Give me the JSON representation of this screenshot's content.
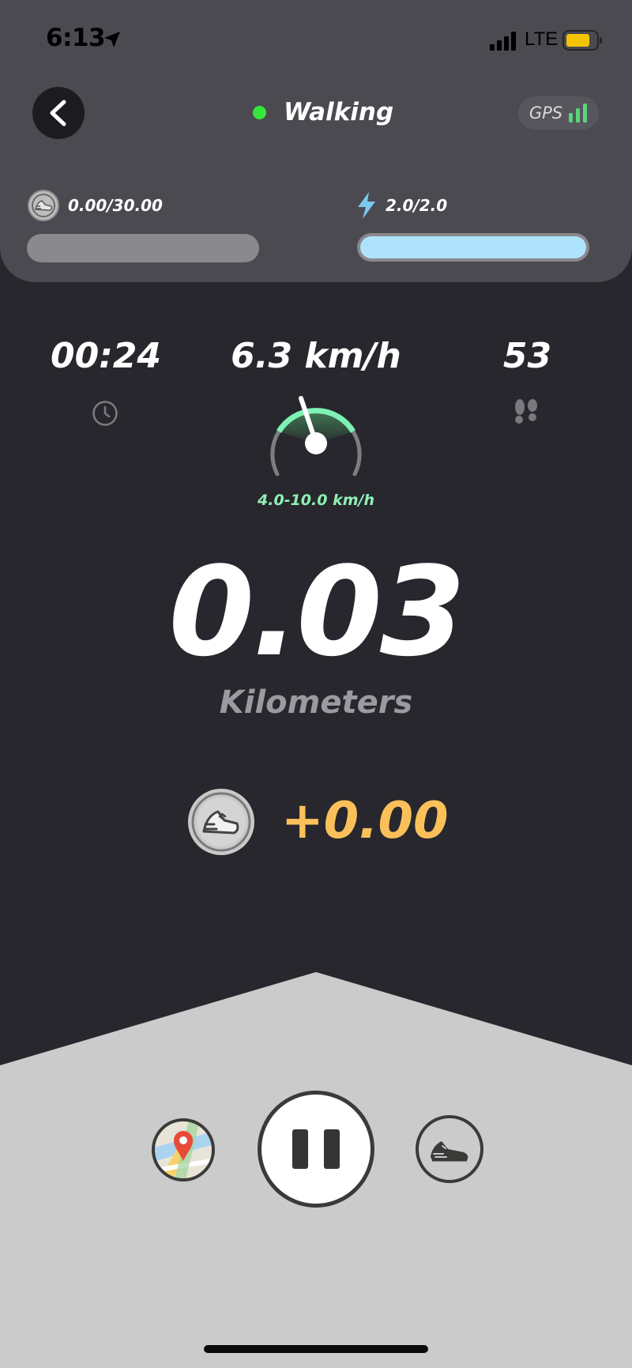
{
  "status_bar": {
    "time": "6:13",
    "network": "LTE",
    "battery_color": "#f5c400"
  },
  "header": {
    "mode_label": "Walking",
    "mode_status_color": "#35e63a",
    "gps_label": "GPS"
  },
  "energy": {
    "earnings_progress": "0.00/30.00",
    "energy_value": "2.0/2.0",
    "energy_fill_fraction": 1.0,
    "energy_fill_color": "#aee3fb"
  },
  "stats": {
    "elapsed": "00:24",
    "speed": "6.3 km/h",
    "steps": "53",
    "speed_range": "4.0-10.0 km/h"
  },
  "distance": {
    "value": "0.03",
    "unit": "Kilometers"
  },
  "reward": {
    "value": "+0.00",
    "color": "#fbc05a"
  },
  "icons": {
    "back": "chevron-left-icon",
    "location": "location-arrow-icon",
    "gps_signal": "signal-bars-icon",
    "token": "sneaker-coin-icon",
    "energy": "lightning-icon",
    "timer": "clock-icon",
    "steps": "footprints-icon",
    "map": "map-pin-icon",
    "pause": "pause-icon",
    "shoe": "sneaker-icon"
  }
}
